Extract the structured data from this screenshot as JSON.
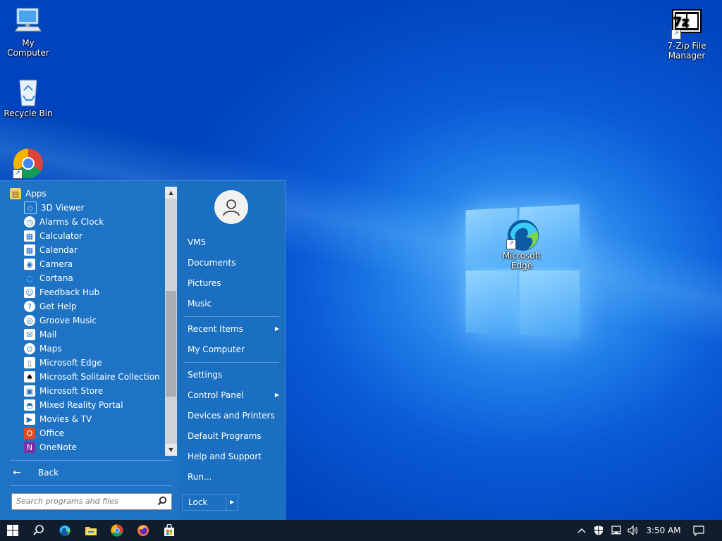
{
  "desktop": {
    "icons": [
      {
        "label": "My Computer",
        "icon": "computer-icon"
      },
      {
        "label": "Recycle Bin",
        "icon": "recycle-bin-icon"
      },
      {
        "label": "",
        "icon": "chrome-icon"
      },
      {
        "label": "7-Zip File Manager",
        "icon": "7zip-icon",
        "badge": "7z"
      },
      {
        "label": "Microsoft Edge",
        "icon": "edge-icon"
      }
    ]
  },
  "start_menu": {
    "apps_header": "Apps",
    "apps": [
      {
        "label": "3D Viewer",
        "icon": "cube-icon"
      },
      {
        "label": "Alarms & Clock",
        "icon": "alarm-clock-icon"
      },
      {
        "label": "Calculator",
        "icon": "calculator-icon"
      },
      {
        "label": "Calendar",
        "icon": "calendar-icon"
      },
      {
        "label": "Camera",
        "icon": "camera-icon"
      },
      {
        "label": "Cortana",
        "icon": "cortana-icon"
      },
      {
        "label": "Feedback Hub",
        "icon": "feedback-icon"
      },
      {
        "label": "Get Help",
        "icon": "help-icon"
      },
      {
        "label": "Groove Music",
        "icon": "music-icon"
      },
      {
        "label": "Mail",
        "icon": "mail-icon"
      },
      {
        "label": "Maps",
        "icon": "map-pin-icon"
      },
      {
        "label": "Microsoft Edge",
        "icon": "document-icon"
      },
      {
        "label": "Microsoft Solitaire Collection",
        "icon": "cards-icon"
      },
      {
        "label": "Microsoft Store",
        "icon": "store-icon"
      },
      {
        "label": "Mixed Reality Portal",
        "icon": "headset-icon"
      },
      {
        "label": "Movies & TV",
        "icon": "clapper-icon"
      },
      {
        "label": "Office",
        "icon": "office-icon"
      },
      {
        "label": "OneNote",
        "icon": "onenote-icon"
      }
    ],
    "back_label": "Back",
    "search_placeholder": "Search programs and files",
    "right_items": {
      "user": "VM5",
      "documents": "Documents",
      "pictures": "Pictures",
      "music": "Music",
      "recent_items": "Recent Items",
      "my_computer": "My Computer",
      "settings": "Settings",
      "control_panel": "Control Panel",
      "devices_printers": "Devices and Printers",
      "default_programs": "Default Programs",
      "help_support": "Help and Support",
      "run": "Run..."
    },
    "lock_label": "Lock"
  },
  "taskbar": {
    "clock": "3:50 AM"
  },
  "colors": {
    "start_bg": "#1a6fc1",
    "taskbar_bg": "#101d2c"
  }
}
